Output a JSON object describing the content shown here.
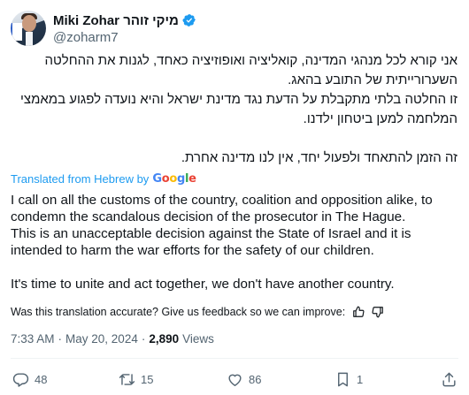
{
  "author": {
    "name": "Miki Zohar מיקי זוהר",
    "handle": "@zoharm7"
  },
  "tweet": {
    "hebrew_paragraphs": [
      "אני קורא לכל מנהגי המדינה, קואליציה ואופוזיציה כאחד, לגנות את ההחלטה השערורייתית של התובע בהאג.",
      "זו החלטה בלתי מתקבלת על הדעת נגד מדינת ישראל והיא נועדה לפגוע במאמצי המלחמה למען ביטחון ילדנו.",
      "זה הזמן להתאחד ולפעול יחד, אין לנו מדינה אחרת."
    ],
    "translated_label": "Translated from Hebrew by",
    "translator_logo": "Google",
    "english_paragraphs": [
      "I call on all the customs of the country, coalition and opposition alike, to condemn the scandalous decision of the prosecutor in The Hague.",
      "This is an unacceptable decision against the State of Israel and it is intended to harm the war efforts for the safety of our children.",
      "It's time to unite and act together, we don't have another country."
    ],
    "feedback_prompt": "Was this translation accurate? Give us feedback so we can improve:",
    "time": "7:33 AM",
    "date": "May 20, 2024",
    "views_count": "2,890",
    "views_label": "Views"
  },
  "actions": {
    "replies": "48",
    "reposts": "15",
    "likes": "86",
    "bookmarks": "1"
  },
  "colors": {
    "link": "#1d9bf0",
    "text": "#0f1419",
    "secondary": "#536471",
    "verified": "#1d9bf0"
  },
  "icons": [
    "verified-badge-icon",
    "thumbs-up-icon",
    "thumbs-down-icon",
    "reply-icon",
    "repost-icon",
    "like-icon",
    "bookmark-icon",
    "share-icon"
  ]
}
